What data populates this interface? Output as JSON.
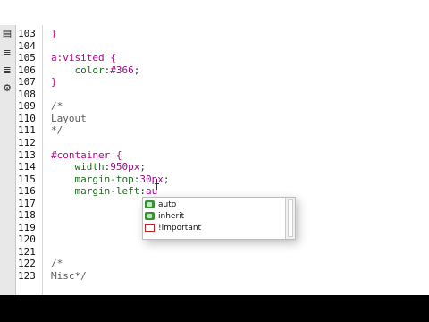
{
  "toolbar": {
    "icons": [
      "format-icon",
      "indent-icon",
      "outdent-icon",
      "settings-icon"
    ]
  },
  "lines": [
    {
      "num": "103",
      "tokens": [
        {
          "t": "}",
          "c": "sel"
        }
      ]
    },
    {
      "num": "104",
      "tokens": []
    },
    {
      "num": "105",
      "tokens": [
        {
          "t": "a:visited {",
          "c": "sel"
        }
      ]
    },
    {
      "num": "106",
      "tokens": [
        {
          "t": "    ",
          "c": "punct"
        },
        {
          "t": "color",
          "c": "prop"
        },
        {
          "t": ":",
          "c": "punct"
        },
        {
          "t": "#366",
          "c": "val"
        },
        {
          "t": ";",
          "c": "punct"
        }
      ]
    },
    {
      "num": "107",
      "tokens": [
        {
          "t": "}",
          "c": "sel"
        }
      ]
    },
    {
      "num": "108",
      "tokens": []
    },
    {
      "num": "109",
      "tokens": [
        {
          "t": "/*",
          "c": "cmt"
        }
      ]
    },
    {
      "num": "110",
      "tokens": [
        {
          "t": "Layout",
          "c": "cmt"
        }
      ]
    },
    {
      "num": "111",
      "tokens": [
        {
          "t": "*/",
          "c": "cmt"
        }
      ]
    },
    {
      "num": "112",
      "tokens": []
    },
    {
      "num": "113",
      "tokens": [
        {
          "t": "#container {",
          "c": "sel"
        }
      ]
    },
    {
      "num": "114",
      "tokens": [
        {
          "t": "    ",
          "c": "punct"
        },
        {
          "t": "width",
          "c": "prop"
        },
        {
          "t": ":",
          "c": "punct"
        },
        {
          "t": "950px",
          "c": "val"
        },
        {
          "t": ";",
          "c": "punct"
        }
      ]
    },
    {
      "num": "115",
      "tokens": [
        {
          "t": "    ",
          "c": "punct"
        },
        {
          "t": "margin-top",
          "c": "prop"
        },
        {
          "t": ":",
          "c": "punct"
        },
        {
          "t": "30px",
          "c": "val"
        },
        {
          "t": ";",
          "c": "punct"
        }
      ]
    },
    {
      "num": "116",
      "tokens": [
        {
          "t": "    ",
          "c": "punct"
        },
        {
          "t": "margin-left",
          "c": "prop"
        },
        {
          "t": ":",
          "c": "punct"
        },
        {
          "t": "au",
          "c": "val"
        }
      ]
    },
    {
      "num": "117",
      "tokens": []
    },
    {
      "num": "118",
      "tokens": []
    },
    {
      "num": "119",
      "tokens": []
    },
    {
      "num": "120",
      "tokens": []
    },
    {
      "num": "121",
      "tokens": []
    },
    {
      "num": "122",
      "tokens": [
        {
          "t": "/*",
          "c": "cmt"
        }
      ]
    },
    {
      "num": "123",
      "tokens": [
        {
          "t": "Misc*/",
          "c": "cmt"
        }
      ]
    }
  ],
  "autocomplete": {
    "items": [
      {
        "label": "auto",
        "icon": "value-icon"
      },
      {
        "label": "inherit",
        "icon": "value-icon"
      },
      {
        "label": "!important",
        "icon": "important-icon"
      }
    ]
  }
}
